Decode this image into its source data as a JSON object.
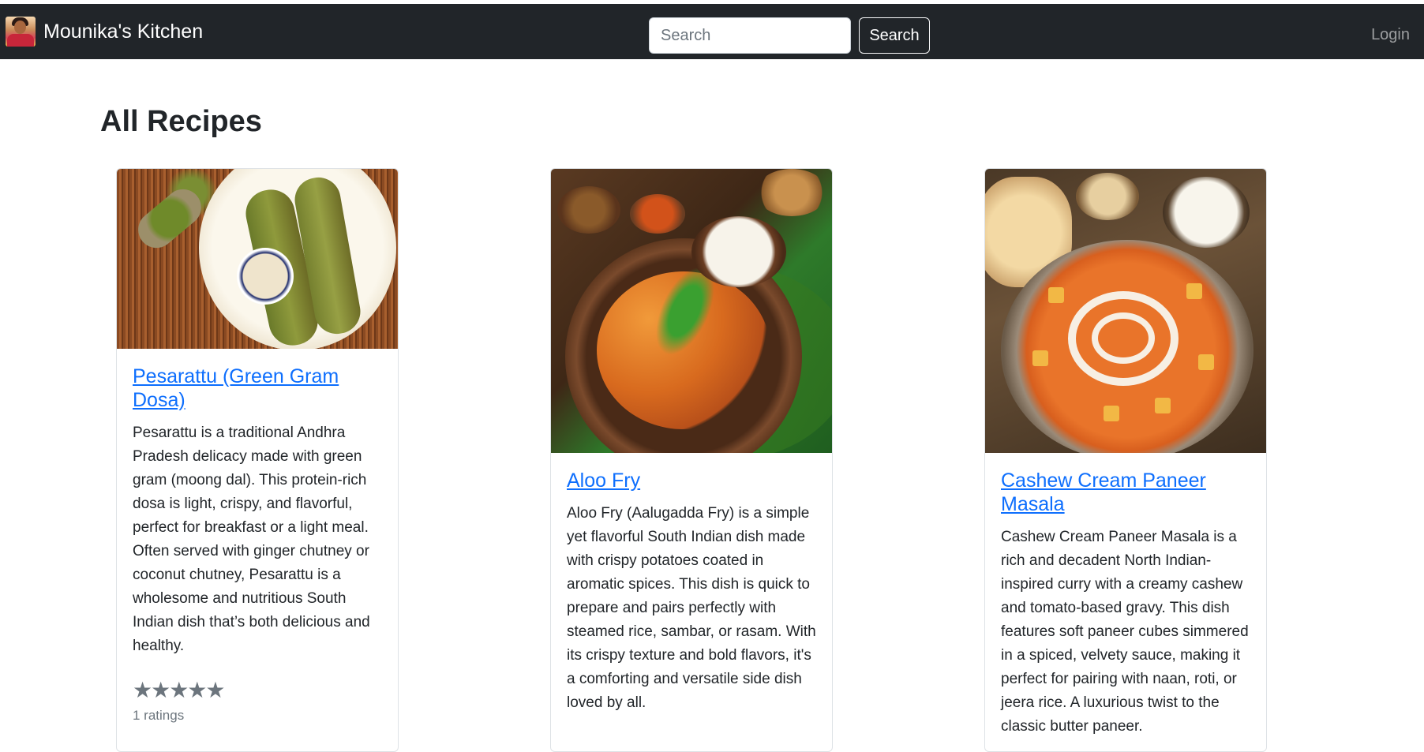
{
  "header": {
    "brand_name": "Mounika's Kitchen",
    "search_placeholder": "Search",
    "search_button_label": "Search",
    "login_label": "Login"
  },
  "page": {
    "title": "All Recipes"
  },
  "recipes": [
    {
      "title": "Pesarattu (Green Gram Dosa)",
      "description": "Pesarattu is a traditional Andhra Pradesh delicacy made with green gram (moong dal). This protein-rich dosa is light, crispy, and flavorful, perfect for breakfast or a light meal. Often served with ginger chutney or coconut chutney, Pesarattu is a wholesome and nutritious South Indian dish that’s both delicious and healthy.",
      "stars": "★★★★★",
      "rating_value": 0,
      "ratings_text": "1 ratings"
    },
    {
      "title": "Aloo Fry",
      "description": "Aloo Fry (Aalugadda Fry) is a simple yet flavorful South Indian dish made with crispy potatoes coated in aromatic spices. This dish is quick to prepare and pairs perfectly with steamed rice, sambar, or rasam. With its crispy texture and bold flavors, it's a comforting and versatile side dish loved by all."
    },
    {
      "title": "Cashew Cream Paneer Masala",
      "description": "Cashew Cream Paneer Masala is a rich and decadent North Indian-inspired curry with a creamy cashew and tomato-based gravy. This dish features soft paneer cubes simmered in a spiced, velvety sauce, making it perfect for pairing with naan, roti, or jeera rice. A luxurious twist to the classic butter paneer."
    }
  ],
  "icons": {
    "brand": "brand-avatar-icon",
    "rating": "star-icon"
  },
  "colors": {
    "navbar_bg": "#212529",
    "link": "#0d6efd",
    "muted": "#6c757d"
  }
}
